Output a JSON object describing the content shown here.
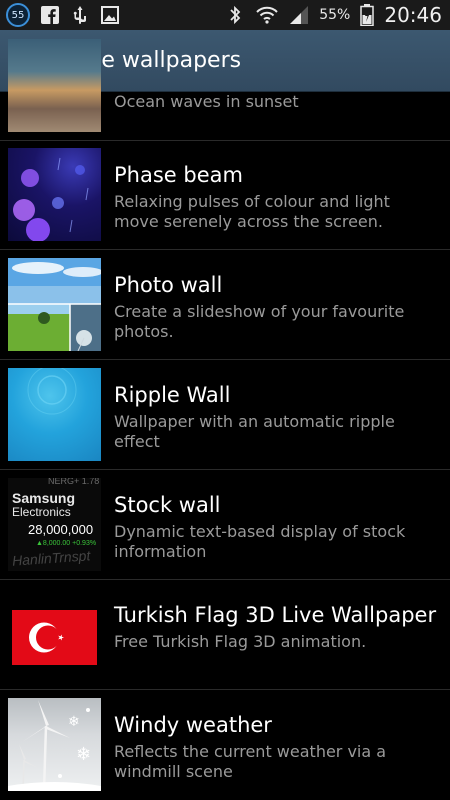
{
  "status_bar": {
    "notification_count": "55",
    "battery_percent": "55%",
    "time": "20:46",
    "icons": [
      "facebook-icon",
      "usb-icon",
      "image-icon",
      "bluetooth-icon",
      "wifi-icon",
      "signal-icon",
      "battery-icon"
    ]
  },
  "action_bar": {
    "title": "Live wallpapers",
    "icon": "live-wallpapers-app-icon"
  },
  "thumb_text": {
    "samsung": "Samsung",
    "electronics": "Electronics",
    "price": "28,000,000",
    "change": "▲8,000.00 +0.93%",
    "ticker_top": "NERG+  1.78",
    "ticker_bottom": "HanlinTrnspt"
  },
  "items": [
    {
      "title": "",
      "description": "Ocean waves in sunset",
      "thumb": "sunset"
    },
    {
      "title": "Phase beam",
      "description": "Relaxing pulses of colour and light move serenely across the screen.",
      "thumb": "phase"
    },
    {
      "title": "Photo wall",
      "description": "Create a slideshow of your favourite photos.",
      "thumb": "photo"
    },
    {
      "title": "Ripple Wall",
      "description": "Wallpaper with an automatic ripple effect",
      "thumb": "ripple"
    },
    {
      "title": "Stock wall",
      "description": "Dynamic text-based display of stock information",
      "thumb": "stock"
    },
    {
      "title": "Turkish Flag 3D Live Wallpaper",
      "description": "Free Turkish Flag 3D animation.",
      "thumb": "flag"
    },
    {
      "title": "Windy weather",
      "description": "Reflects the current weather via a windmill scene",
      "thumb": "windy"
    }
  ],
  "colors": {
    "action_bar": "#3c5870",
    "divider": "#2a2a2a",
    "description_text": "#9a9a9a",
    "flag_red": "#e30a17"
  }
}
